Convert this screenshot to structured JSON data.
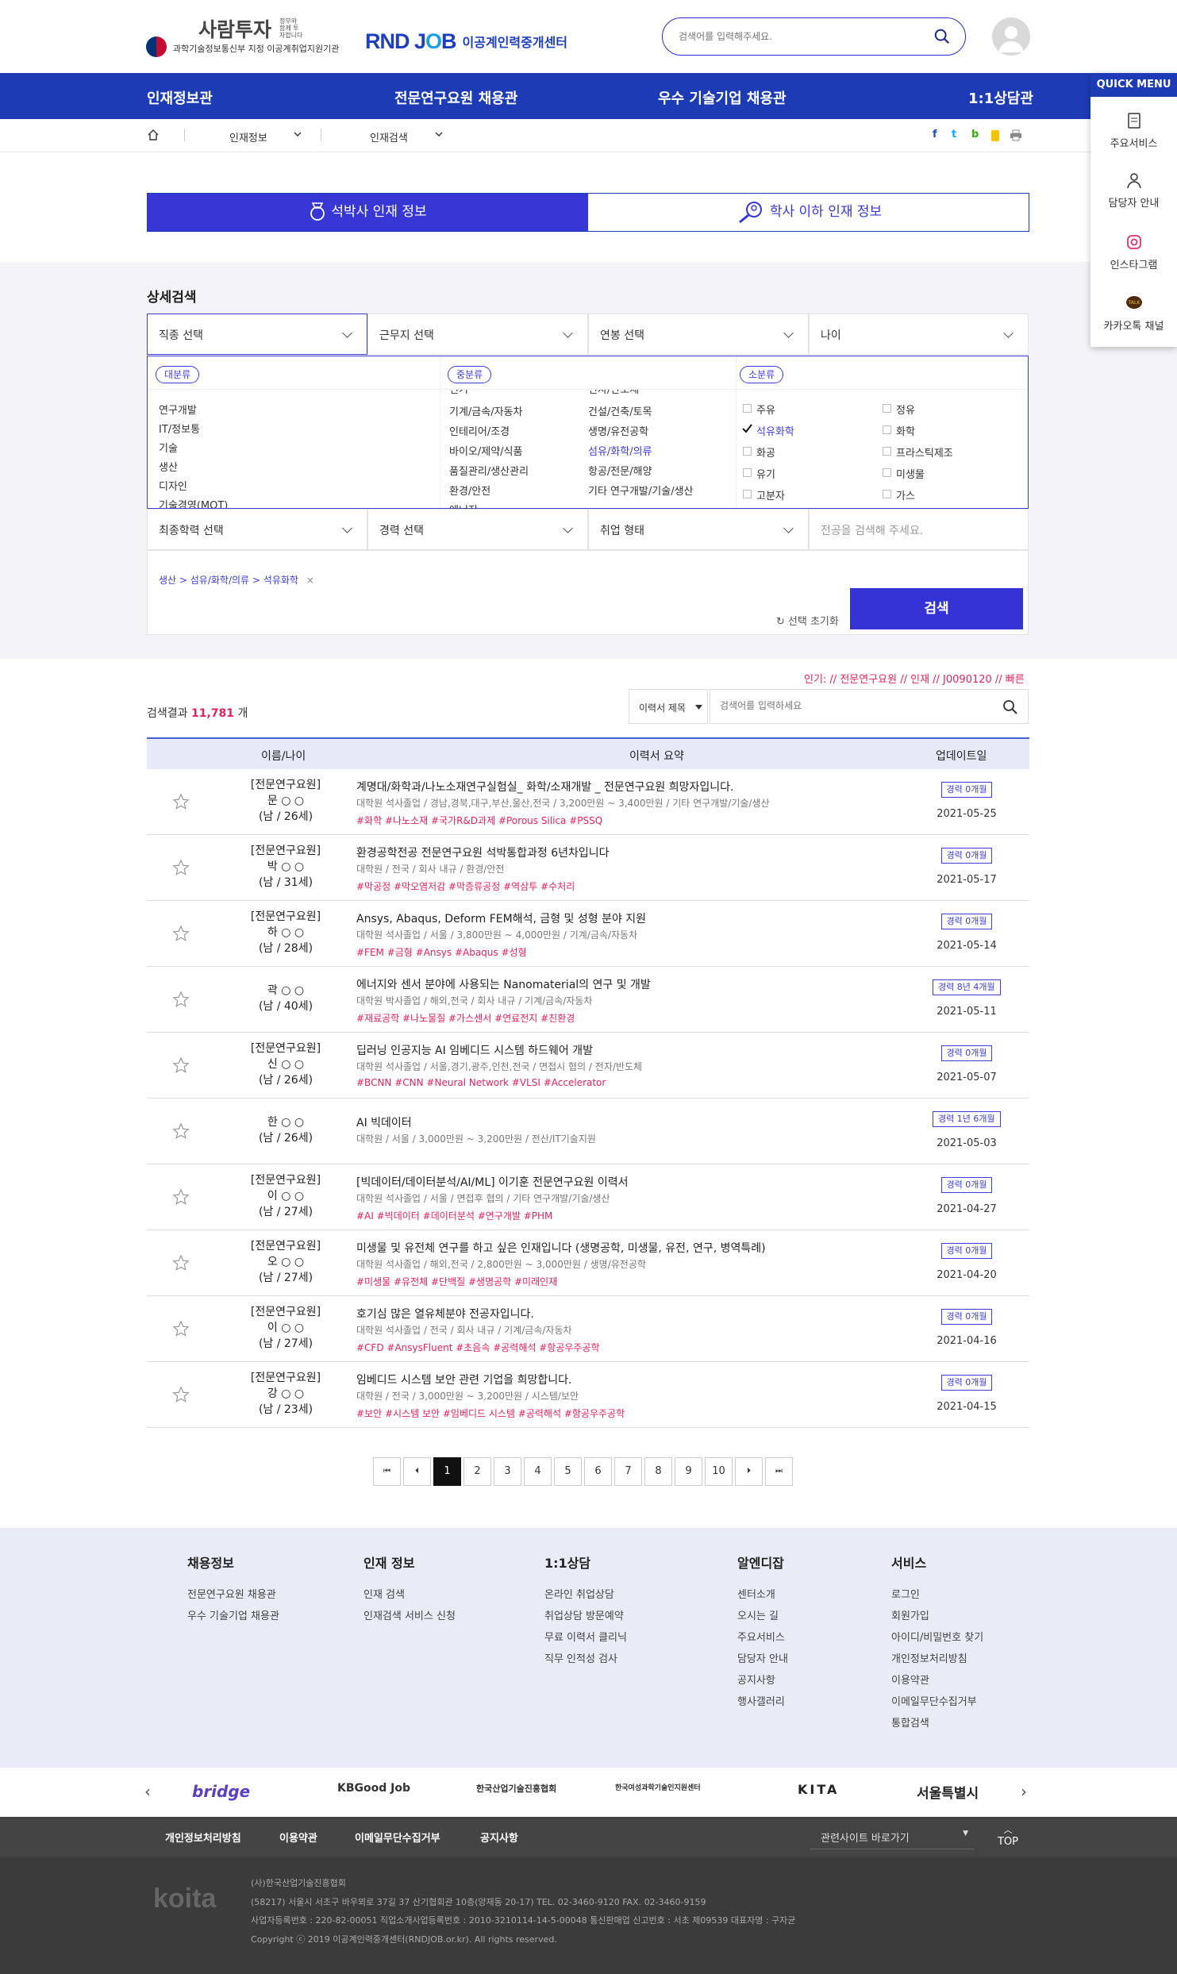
{
  "header": {
    "logo_main": "사람투자",
    "logo_small": "정부와 함께 투자합니다",
    "logo_sub": "과학기술정보통신부 지정 이공계취업지원기관",
    "rnd_text": "이공계인력중개센터",
    "search_placeholder": "검색어를 입력해주세요."
  },
  "nav": [
    "인재정보관",
    "전문연구요원 채용관",
    "우수 기술기업 채용관",
    "1:1상담관"
  ],
  "quick": {
    "title": "QUICK MENU",
    "items": [
      "주요서비스",
      "담당자 안내",
      "인스타그램",
      "카카오톡 채널"
    ]
  },
  "breadcrumb": [
    "인재정보",
    "인재검색"
  ],
  "tabs": [
    "석박사 인재 정보",
    "학사 이하 인재 정보"
  ],
  "search": {
    "title": "상세검색",
    "selects_row1": [
      "직종 선택",
      "근무지 선택",
      "연봉 선택",
      "나이"
    ],
    "selects_row2": [
      "최종학력 선택",
      "경력 선택",
      "취업 형태"
    ],
    "keyword_placeholder": "전공을 검색해 주세요.",
    "category_labels": [
      "대분류",
      "중분류",
      "소분류"
    ],
    "major": [
      "연구개발",
      "IT/정보통",
      "기술",
      "생산",
      "디자인",
      "기술경영(MOT)"
    ],
    "middle_left": [
      "전기",
      "기계/금속/자동차",
      "인테리어/조경",
      "바이오/제약/식품",
      "품질관리/생산관리",
      "환경/안전",
      "에너지"
    ],
    "middle_right": [
      "전자/반도체",
      "건설/건축/토목",
      "생명/유전공학",
      "섬유/화학/의류",
      "항공/전문/해양",
      "기타 연구개발/기술/생산"
    ],
    "minor_left": [
      "주유",
      "석유화학",
      "화공",
      "유기",
      "고분자"
    ],
    "minor_right": [
      "정유",
      "화학",
      "프라스틱제조",
      "미생물",
      "가스"
    ],
    "selected_chip": "생산 > 섬유/화학/의류 > 석유화학",
    "reset": "선택 초기화",
    "button": "검색"
  },
  "results": {
    "popular": "인기:  // 전문연구요원 // 인재 // J0090120 // 빠른",
    "count_prefix": "검색결과",
    "count": "11,781",
    "count_suffix": "개",
    "filter": "이력서 제목",
    "search_placeholder": "검색어를 입력하세요",
    "headers": [
      "이름/나이",
      "이력서 요약",
      "업데이트일"
    ],
    "rows": [
      {
        "tag": "[전문연구요원]",
        "name": "문 ○ ○",
        "age": "(남 / 26세)",
        "title": "계명대/화학과/나노소재연구실험실_ 화학/소재개발 _ 전문연구요원 희망자입니다.",
        "meta": "대학원 석사졸업 / 경남,경북,대구,부산,울산,전국 / 3,200만원 ~ 3,400만원 / 기타 연구개발/기술/생산",
        "tags": "#화학  #나노소재  #국가R&D과제  #Porous Silica  #PSSQ",
        "badge": "경력 0개월",
        "date": "2021-05-25"
      },
      {
        "tag": "[전문연구요원]",
        "name": "박 ○ ○",
        "age": "(남 / 31세)",
        "title": "환경공학전공 전문연구요원 석박통합과정 6년차입니다",
        "meta": "대학원 / 전국 / 회사 내규 / 환경/안전",
        "tags": "#막공정  #막오염저감  #막증류공정  #역삼투  #수처리",
        "badge": "경력 0개월",
        "date": "2021-05-17"
      },
      {
        "tag": "[전문연구요원]",
        "name": "하 ○ ○",
        "age": "(남 / 28세)",
        "title": "Ansys, Abaqus, Deform FEM해석, 금형 및 성형 분야 지원",
        "meta": "대학원 석사졸업 / 서울 / 3,800만원 ~ 4,000만원 / 기계/금속/자동차",
        "tags": "#FEM  #금형  #Ansys  #Abaqus  #성형",
        "badge": "경력 0개월",
        "date": "2021-05-14"
      },
      {
        "tag": "",
        "name": "곽 ○ ○",
        "age": "(남 / 40세)",
        "title": "에너지와 센서 분야에 사용되는 Nanomaterial의 연구 및 개발",
        "meta": "대학원 박사졸업 / 해외,전국 / 회사 내규 / 기계/금속/자동차",
        "tags": "#재료공학  #나노물질  #가스센서  #연료전지  #친환경",
        "badge": "경력 8년 4개월",
        "date": "2021-05-11"
      },
      {
        "tag": "[전문연구요원]",
        "name": "신 ○ ○",
        "age": "(남 / 26세)",
        "title": "딥러닝 인공지능 AI 임베디드 시스템 하드웨어 개발",
        "meta": "대학원 석사졸업 / 서울,경기,광주,인천,전국 / 면접시 협의 / 전자/반도체",
        "tags": "#BCNN  #CNN  #Neural Network  #VLSI  #Accelerator",
        "badge": "경력 0개월",
        "date": "2021-05-07"
      },
      {
        "tag": "",
        "name": "한 ○ ○",
        "age": "(남 / 26세)",
        "title": "AI 빅데이터",
        "meta": "대학원 / 서울 / 3,000만원 ~ 3,200만원 / 전산/IT기술지원",
        "tags": "",
        "badge": "경력 1년 6개월",
        "date": "2021-05-03"
      },
      {
        "tag": "[전문연구요원]",
        "name": "이 ○ ○",
        "age": "(남 / 27세)",
        "title": "[빅데이터/데이터분석/AI/ML] 이기훈 전문연구요원 이력서",
        "meta": "대학원 석사졸업 / 서울 / 면접후 협의 / 기타 연구개발/기술/생산",
        "tags": "#AI  #빅데이터  #데이터분석  #연구개발  #PHM",
        "badge": "경력 0개월",
        "date": "2021-04-27"
      },
      {
        "tag": "[전문연구요원]",
        "name": "오 ○ ○",
        "age": "(남 / 27세)",
        "title": "미생물 및 유전체 연구를 하고 싶은 인재입니다 (생명공학, 미생물, 유전, 연구, 병역특례)",
        "meta": "대학원 석사졸업 / 해외,전국 / 2,800만원 ~ 3,000만원 / 생명/유전공학",
        "tags": "#미생물  #유전체  #단백질  #생명공학  #미래인재",
        "badge": "경력 0개월",
        "date": "2021-04-20"
      },
      {
        "tag": "[전문연구요원]",
        "name": "이 ○ ○",
        "age": "(남 / 27세)",
        "title": "호기심 많은 열유체분야 전공자입니다.",
        "meta": "대학원 석사졸업 / 전국 / 회사 내규 / 기계/금속/자동차",
        "tags": "#CFD  #AnsysFluent  #초음속  #공력해석  #항공우주공학",
        "badge": "경력 0개월",
        "date": "2021-04-16"
      },
      {
        "tag": "[전문연구요원]",
        "name": "강 ○ ○",
        "age": "(남 / 23세)",
        "title": "임베디드 시스템 보안 관련 기업을 희망합니다.",
        "meta": "대학원 / 전국 / 3,000만원 ~ 3,200만원 / 시스템/보안",
        "tags": "#보안  #시스템 보안  #임베디드 시스템  #공력해석  #항공우주공학",
        "badge": "경력 0개월",
        "date": "2021-04-15"
      }
    ]
  },
  "pager": {
    "first": "⏮",
    "prev": "⏴",
    "pages": [
      "1",
      "2",
      "3",
      "4",
      "5",
      "6",
      "7",
      "8",
      "9",
      "10"
    ],
    "current": "1",
    "next": "⏵",
    "last": "⏭"
  },
  "footer": {
    "cols": [
      {
        "title": "채용정보",
        "links": [
          "전문연구요원 채용관",
          "우수 기술기업 채용관"
        ]
      },
      {
        "title": "인재 정보",
        "links": [
          "인재 검색",
          "인재검색 서비스 신청"
        ]
      },
      {
        "title": "1:1상담",
        "links": [
          "온라인 취업상담",
          "취업상담 방문예약",
          "무료 이력서 클리닉",
          "직무 인적성 검사"
        ]
      },
      {
        "title": "알엔디잡",
        "links": [
          "센터소개",
          "오시는 길",
          "주요서비스",
          "담당자 안내",
          "공지사항",
          "행사갤러리"
        ]
      },
      {
        "title": "서비스",
        "links": [
          "로그인",
          "회원가입",
          "아이디/비밀번호 찾기",
          "개인정보처리방침",
          "이용약관",
          "이메일무단수집거부",
          "통합검색"
        ]
      }
    ],
    "partners": [
      "bridge",
      "KBGood Job",
      "한국산업기술진흥협회",
      "한국여성과학기술인지원센터",
      "KITA",
      "서울특별시"
    ],
    "bar_links": [
      "개인정보처리방침",
      "이용약관",
      "이메일무단수집거부",
      "공지사항"
    ],
    "related": "관련사이트 바로가기",
    "top": "TOP",
    "logo": "koita",
    "addr": [
      "(사)한국산업기술진흥협회",
      "(58217) 서울시 서초구 바우뫼로 37길 37 산기협회관 10층(양재동 20-17)     TEL. 02-3460-9120     FAX. 02-3460-9159",
      "사업자등록번호 : 220-82-00051     직업소개사업등록번호 : 2010-3210114-14-5-00048     통신판매업 신고번호 : 서초 제09539     대표자명 : 구자균",
      "Copyright ⓒ 2019 이공계인력중개센터(RNDJOB.or.kr). All rights reserved."
    ]
  },
  "colors": {
    "brand": "#1d3bb5",
    "accent": "#3434d6",
    "tag": "#e0245e"
  }
}
